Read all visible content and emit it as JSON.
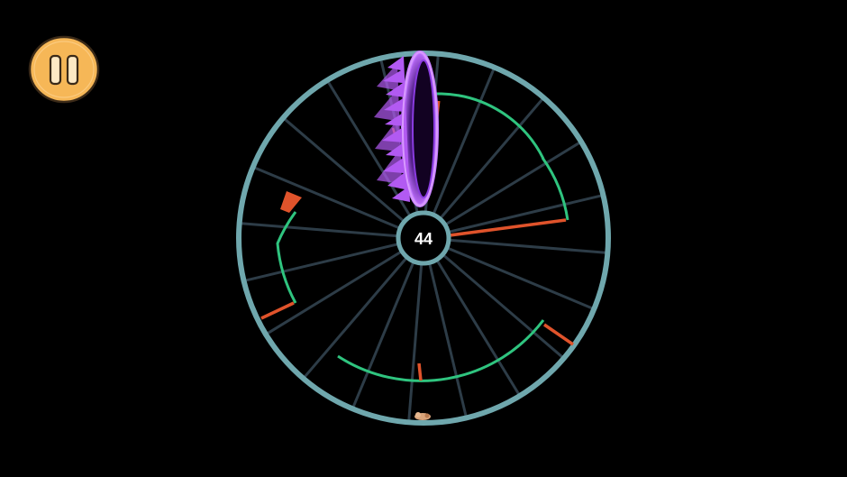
{
  "hud": {
    "score": "44",
    "pause_icon": "pause-icon"
  },
  "colors": {
    "background": "#000000",
    "ring": "#6fa7ad",
    "spokes": "#2d3c47",
    "green_wall": "#2fc47f",
    "red_wall": "#e0532b",
    "portal": "#b050f0",
    "pause_fill": "#f6b757",
    "pause_outline": "#4a3520"
  }
}
